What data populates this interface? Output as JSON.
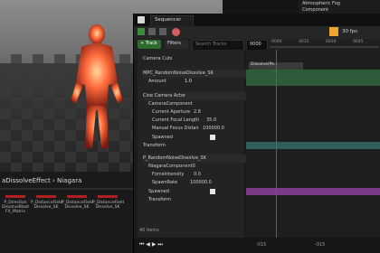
{
  "viewport": {
    "asset_title": "aDissolveEffect  ›  Niagara"
  },
  "assets": [
    {
      "label": "P_Direction\nDissolveBlast\nFX_Matrix"
    },
    {
      "label": "P_DistanceField\nDissolve_SK"
    },
    {
      "label": "P_DistanceField\nDissolve_SK"
    },
    {
      "label": "P_DistanceField\nDissolve_SK"
    }
  ],
  "editor": {
    "tab_title": "Sequencer",
    "track_btn": "+ Track",
    "filters_btn": "Filters",
    "search_placeholder": "Search Tracks",
    "fps": "30 fps",
    "frame": "0000",
    "section_label": "Dissolve(Pe...",
    "rows": [
      {
        "label": "Camera Cuts"
      },
      {
        "label": "MPC_RandomNoiseDissolve_SK"
      },
      {
        "label": "Amount",
        "value": "1.0"
      },
      {
        "label": "Cine Camera Actor"
      },
      {
        "label": "CameraComponent"
      },
      {
        "label": "Current Aperture",
        "value": "2.8"
      },
      {
        "label": "Current Focal Length",
        "value": "35.0"
      },
      {
        "label": "Manual Focus Distan",
        "value": "100000.0"
      },
      {
        "label": "Spawned"
      },
      {
        "label": "Transform"
      },
      {
        "label": "P_RandomNoiseDissolve_SK"
      },
      {
        "label": "NiagaraComponent0"
      },
      {
        "label": "ForceIntensity",
        "value": "0.0"
      },
      {
        "label": "SpawnRate",
        "value": "100000.0"
      },
      {
        "label": "Spawned"
      },
      {
        "label": "Transform"
      }
    ],
    "items_count": "40 items",
    "range_start": "-015",
    "range_end": "-015",
    "right_items": [
      "Atmospheric Fog",
      "Component"
    ],
    "ruler_ticks": [
      "0000",
      "0015",
      "0030",
      "0045"
    ]
  }
}
